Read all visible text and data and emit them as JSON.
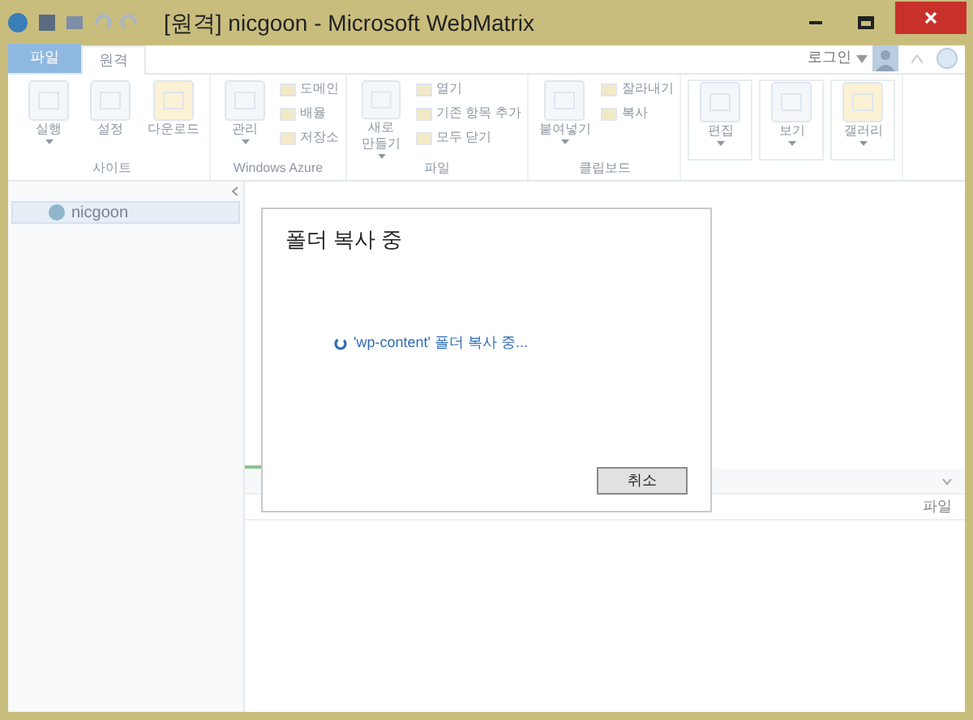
{
  "window": {
    "title": "[원격] nicgoon - Microsoft WebMatrix"
  },
  "tabs": [
    {
      "label": "파일",
      "kind": "file",
      "selected": false
    },
    {
      "label": "원격",
      "kind": "tab",
      "selected": true
    }
  ],
  "account": {
    "label": "로그인"
  },
  "ribbon": {
    "disabled": true,
    "groups": [
      {
        "label": "사이트",
        "items": [
          {
            "label": "실행",
            "kind": "large",
            "dropdown": true
          },
          {
            "label": "설정",
            "kind": "large"
          },
          {
            "label": "다운로드",
            "kind": "large"
          }
        ]
      },
      {
        "label": "Windows Azure",
        "items": [
          {
            "label": "관리",
            "kind": "large",
            "dropdown": true
          },
          {
            "label": "도메인",
            "kind": "small"
          },
          {
            "label": "배율",
            "kind": "small"
          },
          {
            "label": "저장소",
            "kind": "small"
          }
        ]
      },
      {
        "label": "파일",
        "items": [
          {
            "label": "새로\n만들기",
            "kind": "large",
            "dropdown": true
          },
          {
            "label": "열기",
            "kind": "small"
          },
          {
            "label": "기존 항목 추가",
            "kind": "small"
          },
          {
            "label": "모두 닫기",
            "kind": "small"
          }
        ]
      },
      {
        "label": "클립보드",
        "items": [
          {
            "label": "붙여넣기",
            "kind": "large",
            "dropdown": true
          },
          {
            "label": "잘라내기",
            "kind": "small"
          },
          {
            "label": "복사",
            "kind": "small"
          }
        ]
      },
      {
        "items": [
          {
            "label": "편집",
            "kind": "boxed",
            "dropdown": true
          },
          {
            "label": "보기",
            "kind": "boxed",
            "dropdown": true
          },
          {
            "label": "갤러리",
            "kind": "boxed",
            "dropdown": true
          }
        ]
      }
    ]
  },
  "sidebar": {
    "items": [
      {
        "label": "nicgoon",
        "selected": true
      }
    ]
  },
  "bottom_panel": {
    "columns": [
      "파일"
    ]
  },
  "dialog": {
    "title": "폴더 복사 중",
    "message": "'wp-content' 폴더 복사 중...",
    "buttons": [
      "취소"
    ]
  }
}
